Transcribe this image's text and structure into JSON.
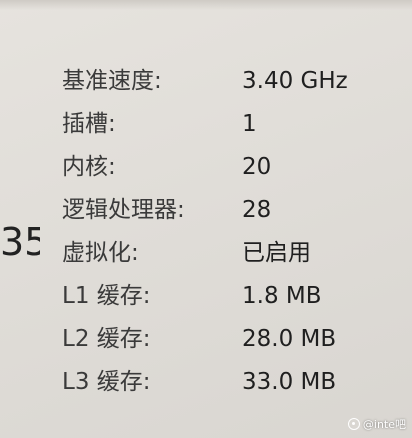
{
  "partial_left_value": "35",
  "specs": [
    {
      "label": "基准速度:",
      "value": "3.40 GHz"
    },
    {
      "label": "插槽:",
      "value": "1"
    },
    {
      "label": "内核:",
      "value": "20"
    },
    {
      "label": "逻辑处理器:",
      "value": "28"
    },
    {
      "label": "虚拟化:",
      "value": "已启用"
    },
    {
      "label": "L1 缓存:",
      "value": "1.8 MB"
    },
    {
      "label": "L2 缓存:",
      "value": "28.0 MB"
    },
    {
      "label": "L3 缓存:",
      "value": "33.0 MB"
    }
  ],
  "watermark": {
    "text": "@inte吧",
    "icon": "tieba-logo-icon"
  }
}
